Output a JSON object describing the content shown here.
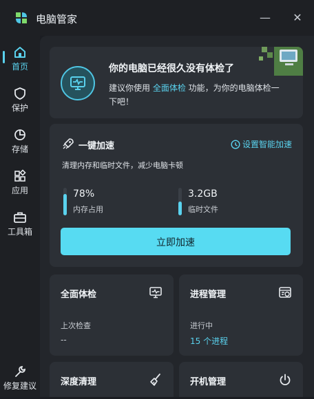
{
  "app": {
    "title": "电脑管家"
  },
  "window": {
    "minimize": "—",
    "close": "✕"
  },
  "sidebar": {
    "items": [
      {
        "label": "首页",
        "icon": "home-icon",
        "active": true
      },
      {
        "label": "保护",
        "icon": "shield-icon"
      },
      {
        "label": "存储",
        "icon": "pie-chart-icon"
      },
      {
        "label": "应用",
        "icon": "apps-grid-icon"
      },
      {
        "label": "工具箱",
        "icon": "toolbox-icon"
      }
    ],
    "footer": {
      "label": "修复建议",
      "icon": "wrench-icon"
    }
  },
  "banner": {
    "title": "你的电脑已经很久没有体检了",
    "text_before": "建议你使用 ",
    "highlight": "全面体检",
    "text_after": " 功能，为你的电脑体检一下吧！",
    "icon": "health-monitor-icon"
  },
  "speedup": {
    "title": "一键加速",
    "icon": "rocket-icon",
    "link": "设置智能加速",
    "link_icon": "settings-clock-icon",
    "description": "清理内存和临时文件，减少电脑卡顿",
    "memory": {
      "value": "78%",
      "label": "内存占用",
      "fill": 0.78
    },
    "temp": {
      "value": "3.2GB",
      "label": "临时文件",
      "fill": 0.5
    },
    "button": "立即加速"
  },
  "cards": {
    "checkup": {
      "title": "全面体检",
      "icon": "monitor-pulse-icon",
      "sub": "上次检查",
      "value": "--"
    },
    "process": {
      "title": "进程管理",
      "icon": "process-window-icon",
      "sub": "进行中",
      "value": "15 个进程"
    },
    "deepclean": {
      "title": "深度清理",
      "icon": "broom-icon"
    },
    "startup": {
      "title": "开机管理",
      "icon": "power-icon"
    }
  },
  "colors": {
    "accent": "#5ad2ee",
    "button": "#57dbf2",
    "background": "#1b1d22",
    "card": "#2c3036"
  }
}
